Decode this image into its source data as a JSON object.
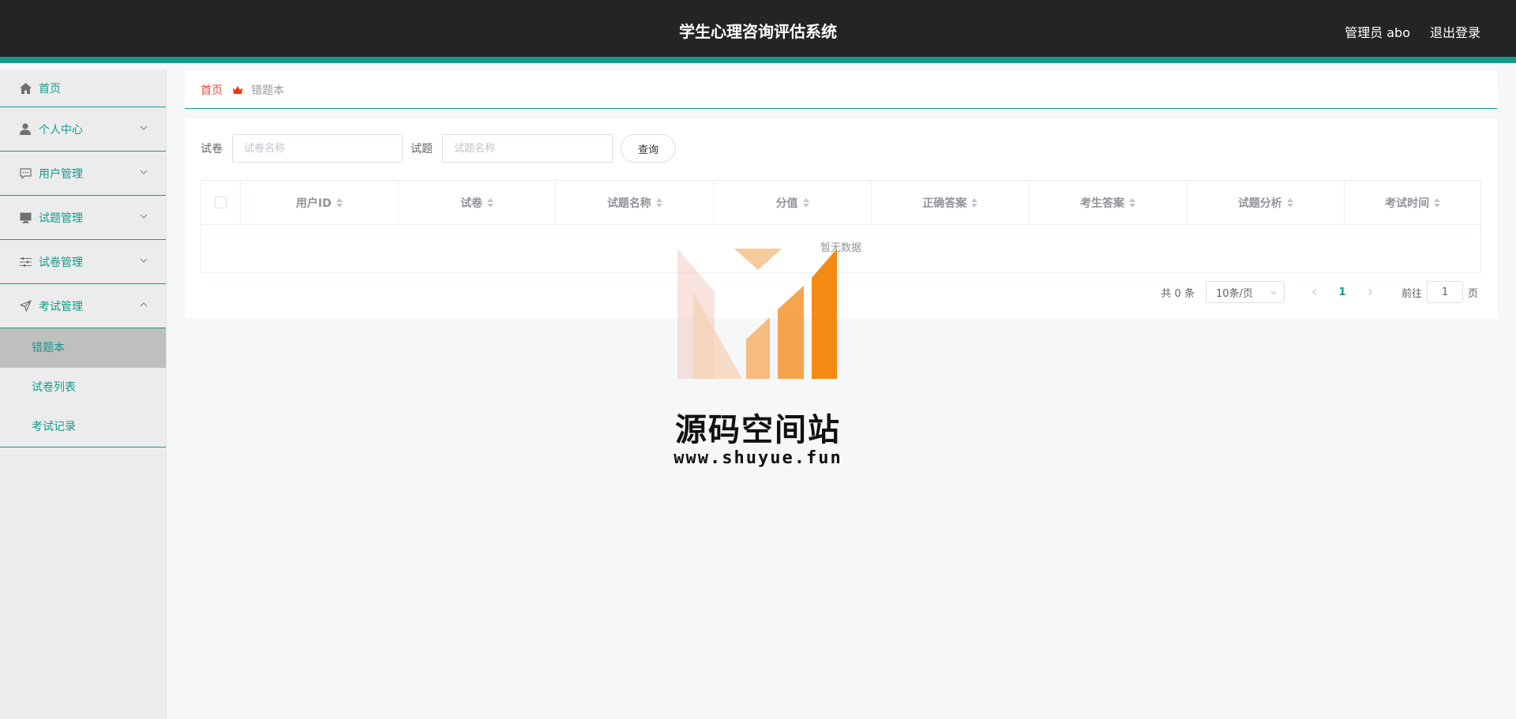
{
  "header": {
    "title": "学生心理咨询评估系统",
    "user_label": "管理员 abo",
    "logout_label": "退出登录"
  },
  "sidebar": {
    "items": [
      {
        "label": "首页",
        "icon": "home-icon"
      },
      {
        "label": "个人中心",
        "icon": "user-icon"
      },
      {
        "label": "用户管理",
        "icon": "chat-icon"
      },
      {
        "label": "试题管理",
        "icon": "monitor-icon"
      },
      {
        "label": "试卷管理",
        "icon": "sliders-icon"
      },
      {
        "label": "考试管理",
        "icon": "send-icon"
      }
    ],
    "sub_items": [
      {
        "label": "错题本",
        "active": true
      },
      {
        "label": "试卷列表",
        "active": false
      },
      {
        "label": "考试记录",
        "active": false
      }
    ]
  },
  "breadcrumb": {
    "home": "首页",
    "current": "错题本"
  },
  "search": {
    "paper_label": "试卷",
    "paper_placeholder": "试卷名称",
    "question_label": "试题",
    "question_placeholder": "试题名称",
    "query_button": "查询"
  },
  "table": {
    "columns": [
      "用户ID",
      "试卷",
      "试题名称",
      "分值",
      "正确答案",
      "考生答案",
      "试题分析",
      "考试时间"
    ],
    "empty_text": "暂无数据"
  },
  "pagination": {
    "total": "共 0 条",
    "page_size": "10条/页",
    "current_page": "1",
    "goto_label": "前往",
    "goto_value": "1",
    "page_unit": "页"
  },
  "watermark": {
    "name": "源码空间站",
    "url": "www.shuyue.fun"
  },
  "colors": {
    "accent": "#149a8c",
    "header_bg": "#242424",
    "breadcrumb_home": "#e54d42"
  }
}
